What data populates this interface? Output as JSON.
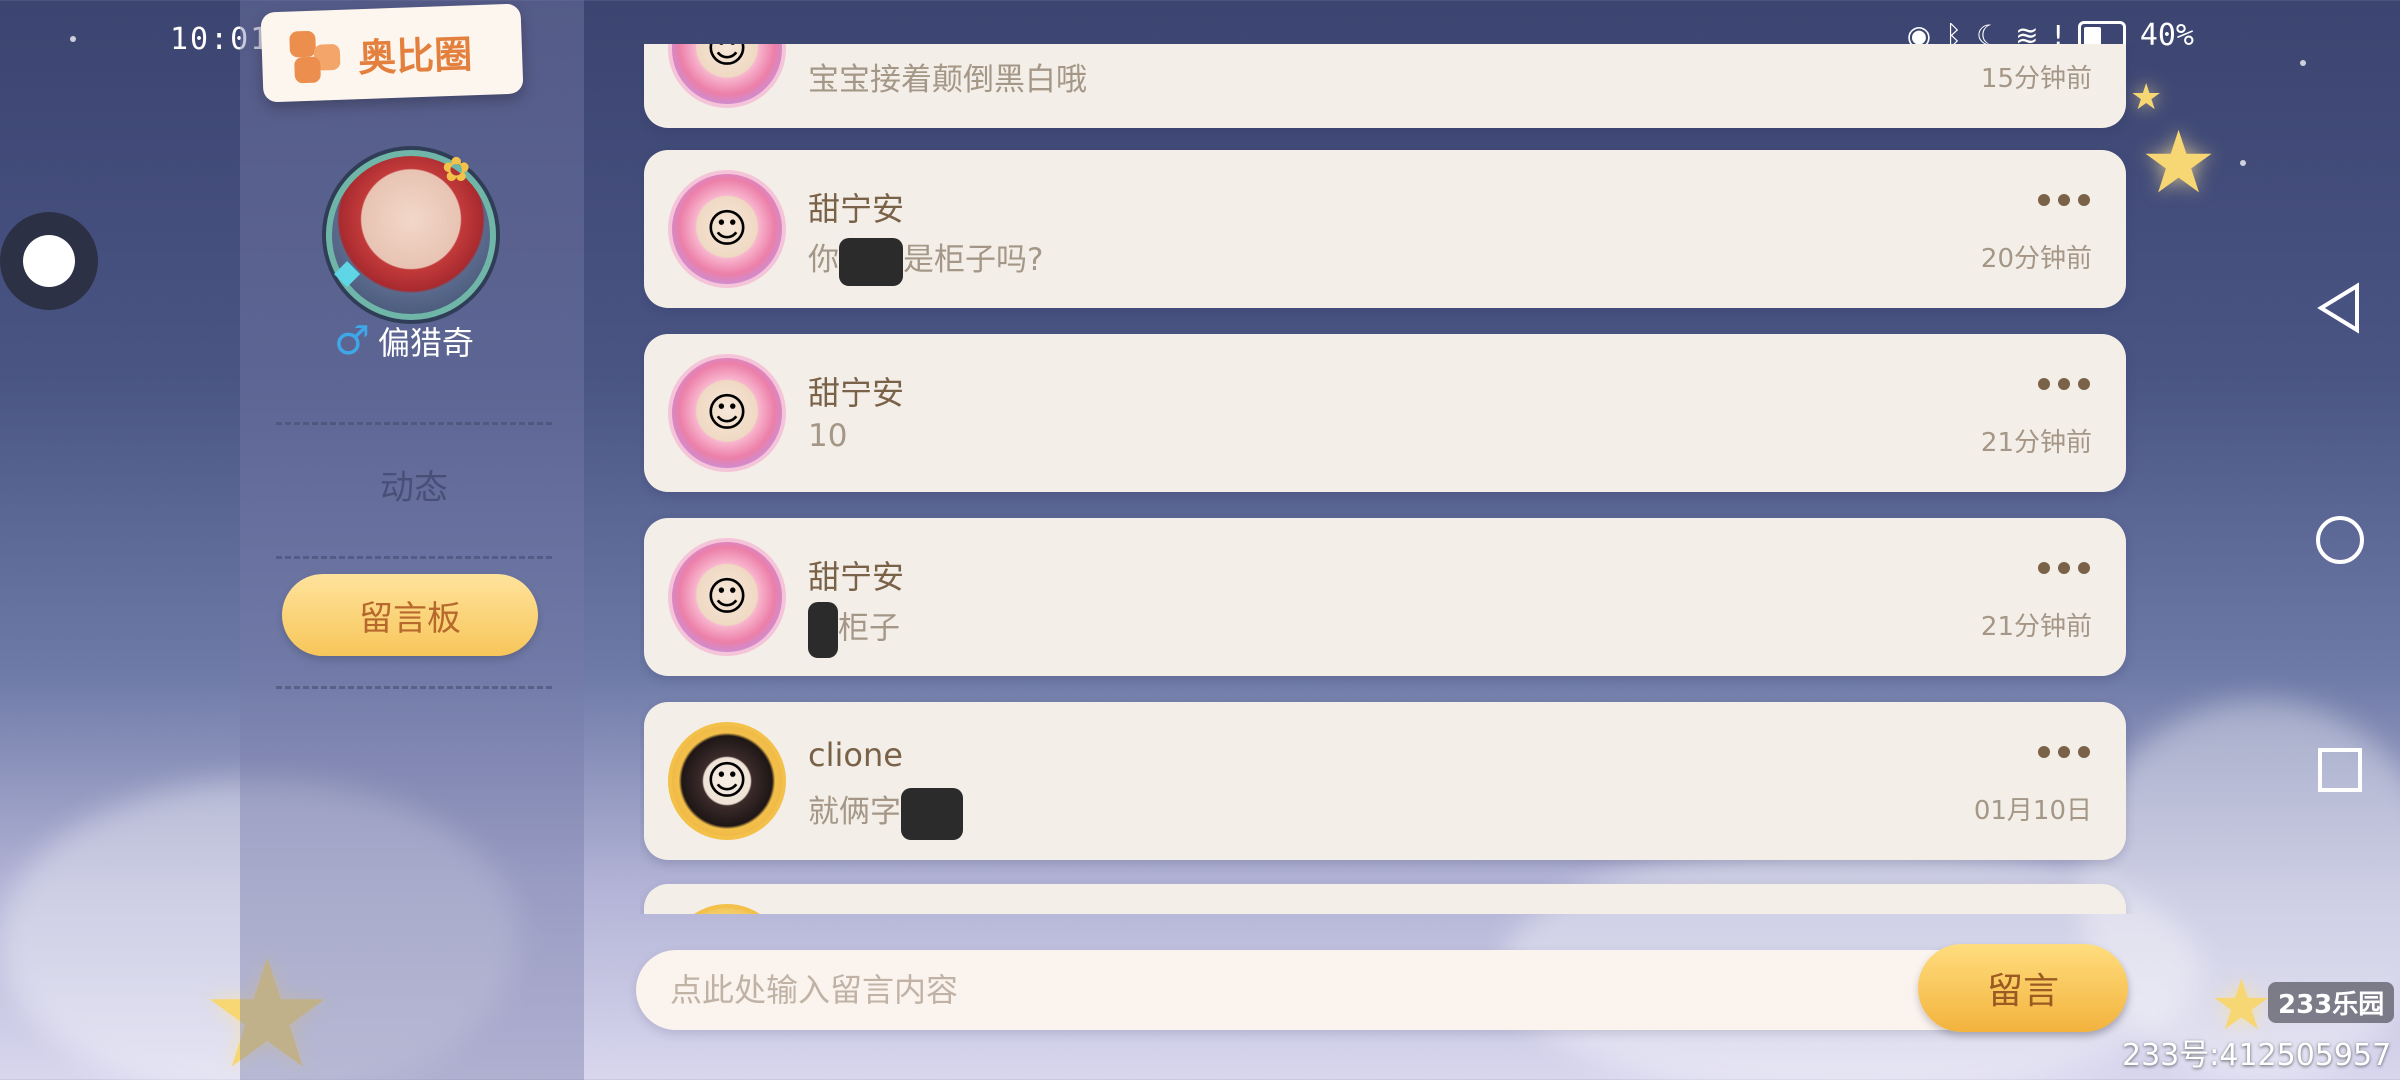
{
  "status_bar": {
    "time": "10:01",
    "battery_percent": "40%",
    "apps": [
      {
        "icon": "app-blue-icon",
        "color": "#3d8ff0"
      },
      {
        "icon": "music-icon",
        "color": "#5f82f0"
      },
      {
        "icon": "search-app-icon",
        "color": "#38a6e8"
      },
      {
        "icon": "video-icon",
        "color": "#f08a2e"
      }
    ]
  },
  "sidebar": {
    "brand": "奥比圈",
    "profile_name": "偏猎奇",
    "gender_symbol": "♂",
    "nav": {
      "dongtai": "动态",
      "board": "留言板"
    }
  },
  "messages": [
    {
      "name": "",
      "content": "宝宝接着颠倒黑白哦",
      "time": "15分钟前"
    },
    {
      "name": "甜宁安",
      "content_pre": "你",
      "content_post": "是柜子吗?",
      "time": "20分钟前"
    },
    {
      "name": "甜宁安",
      "content": "10",
      "time": "21分钟前"
    },
    {
      "name": "甜宁安",
      "content_post": "柜子",
      "time": "21分钟前"
    },
    {
      "name": "clione",
      "content_pre": "就俩字",
      "time": "01月10日"
    }
  ],
  "composer": {
    "placeholder": "点此处输入留言内容",
    "send_label": "留言"
  },
  "watermark": {
    "logo": "233乐园",
    "id": "233号:412505957"
  },
  "colors": {
    "accent": "#f7c65a",
    "card_bg": "#f3efe8",
    "name_text": "#7a6249",
    "muted_text": "#a59787"
  }
}
